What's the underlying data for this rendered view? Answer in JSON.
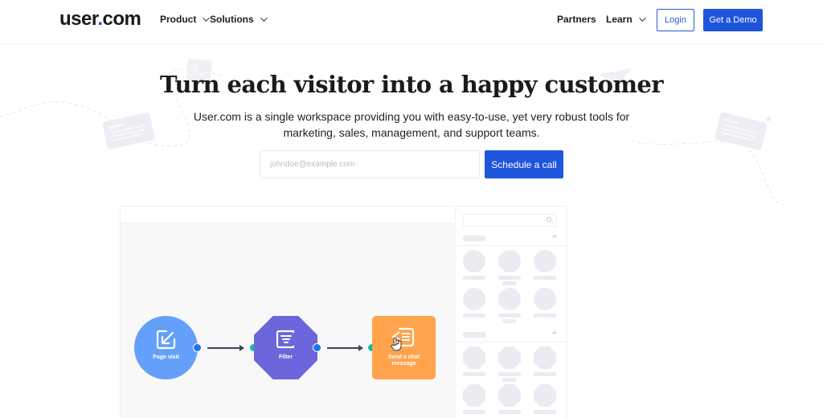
{
  "nav": {
    "logo_main": "user",
    "logo_dot": ".",
    "logo_tail": "com",
    "items_left": [
      {
        "label": "Product",
        "has_dropdown": true
      },
      {
        "label": "Solutions",
        "has_dropdown": true
      }
    ],
    "items_right": [
      {
        "label": "Partners",
        "has_dropdown": false
      },
      {
        "label": "Learn",
        "has_dropdown": true
      }
    ],
    "login_label": "Login",
    "demo_label": "Get a Demo"
  },
  "hero": {
    "title": "Turn each visitor into a happy customer",
    "subtitle": "User.com is a single workspace providing you with easy-to-use, yet very robust tools for marketing, sales, management, and support teams.",
    "email_placeholder": "johndoe@example.com",
    "email_value": "",
    "cta_label": "Schedule a call"
  },
  "flow": {
    "nodes": [
      {
        "label": "Page visit",
        "shape": "circle",
        "icon": "page-visit-icon",
        "color": "#64a0f9"
      },
      {
        "label": "Filter",
        "shape": "octagon",
        "icon": "filter-icon",
        "color": "#6b66dc"
      },
      {
        "label": "Send a chat message",
        "shape": "rounded-square",
        "icon": "chat-message-icon",
        "color": "#ffa44c"
      }
    ],
    "port_out_color": "#1a73f0",
    "port_in_color": "#19b8a0"
  },
  "colors": {
    "brand_blue": "#1f55dd",
    "text_dark": "#1b1b1b"
  }
}
